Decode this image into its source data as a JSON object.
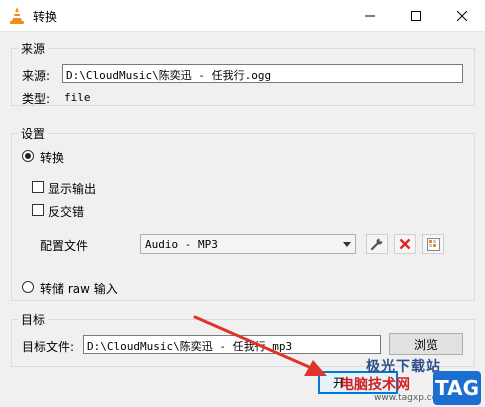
{
  "window": {
    "title": "转换"
  },
  "source": {
    "group_title": "来源",
    "source_label": "来源:",
    "source_value": "D:\\CloudMusic\\陈奕迅 - 任我行.ogg",
    "type_label": "类型:",
    "type_value": "file"
  },
  "settings": {
    "group_title": "设置",
    "convert_label": "转换",
    "show_output_label": "显示输出",
    "deinterlace_label": "反交错",
    "profile_label": "配置文件",
    "profile_value": "Audio - MP3",
    "dump_raw_label": "转储 raw 输入"
  },
  "destination": {
    "group_title": "目标",
    "dest_label": "目标文件:",
    "dest_value": "D:\\CloudMusic\\陈奕迅 - 任我行 mp3",
    "browse_label": "浏览"
  },
  "footer": {
    "start_label": "开"
  },
  "watermark": {
    "site_text": "极光下载站",
    "red_text": "电脑技术网",
    "url_text": "www.tagxp.com",
    "tag_text": "TAG"
  },
  "colors": {
    "arrow": "#e0332b",
    "vlc_orange": "#f28c1e",
    "delete_red": "#d9262b"
  }
}
